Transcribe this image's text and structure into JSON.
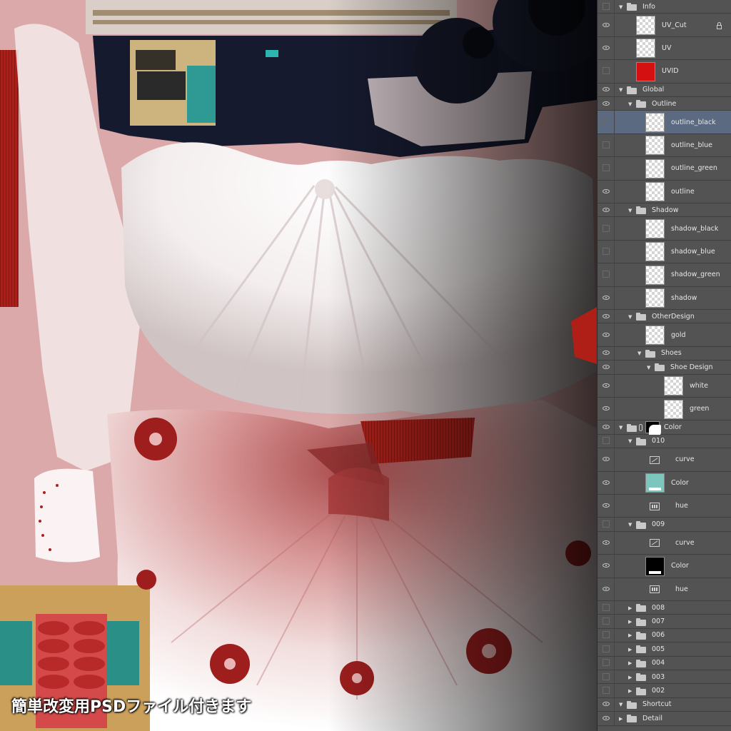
{
  "canvas": {
    "caption": "簡単改変用PSDファイル付きます"
  },
  "layers_panel": {
    "rows": [
      {
        "label": "Info",
        "kind": "group",
        "depth": 0,
        "visible": false,
        "expanded": true,
        "selected": false
      },
      {
        "label": "UV_Cut",
        "kind": "layer",
        "depth": 1,
        "visible": true,
        "thumb": "checker",
        "locked": true,
        "selected": false
      },
      {
        "label": "UV",
        "kind": "layer",
        "depth": 1,
        "visible": true,
        "thumb": "checker",
        "selected": false
      },
      {
        "label": "UVID",
        "kind": "layer",
        "depth": 1,
        "visible": false,
        "thumb": "red",
        "selected": false
      },
      {
        "label": "Global",
        "kind": "group",
        "depth": 0,
        "visible": true,
        "expanded": true,
        "selected": false
      },
      {
        "label": "Outline",
        "kind": "group",
        "depth": 1,
        "visible": true,
        "expanded": true,
        "selected": false
      },
      {
        "label": "outline_black",
        "kind": "layer",
        "depth": 2,
        "visible": false,
        "thumb": "checker",
        "selected": true
      },
      {
        "label": "outline_blue",
        "kind": "layer",
        "depth": 2,
        "visible": false,
        "thumb": "checker",
        "selected": false
      },
      {
        "label": "outline_green",
        "kind": "layer",
        "depth": 2,
        "visible": false,
        "thumb": "checker",
        "selected": false
      },
      {
        "label": "outline",
        "kind": "layer",
        "depth": 2,
        "visible": true,
        "thumb": "checker",
        "selected": false
      },
      {
        "label": "Shadow",
        "kind": "group",
        "depth": 1,
        "visible": true,
        "expanded": true,
        "selected": false
      },
      {
        "label": "shadow_black",
        "kind": "layer",
        "depth": 2,
        "visible": false,
        "thumb": "checker",
        "selected": false
      },
      {
        "label": "shadow_blue",
        "kind": "layer",
        "depth": 2,
        "visible": false,
        "thumb": "checker",
        "selected": false
      },
      {
        "label": "shadow_green",
        "kind": "layer",
        "depth": 2,
        "visible": false,
        "thumb": "checker",
        "selected": false
      },
      {
        "label": "shadow",
        "kind": "layer",
        "depth": 2,
        "visible": true,
        "thumb": "checker",
        "selected": false
      },
      {
        "label": "OtherDesign",
        "kind": "group",
        "depth": 1,
        "visible": true,
        "expanded": true,
        "selected": false
      },
      {
        "label": "gold",
        "kind": "layer",
        "depth": 2,
        "visible": true,
        "thumb": "checker",
        "selected": false
      },
      {
        "label": "Shoes",
        "kind": "group",
        "depth": 2,
        "visible": true,
        "expanded": true,
        "selected": false
      },
      {
        "label": "Shoe Design",
        "kind": "group",
        "depth": 3,
        "visible": true,
        "expanded": true,
        "selected": false
      },
      {
        "label": "white",
        "kind": "layer",
        "depth": 4,
        "visible": true,
        "thumb": "checker",
        "selected": false
      },
      {
        "label": "green",
        "kind": "layer",
        "depth": 4,
        "visible": true,
        "thumb": "checker",
        "selected": false
      },
      {
        "label": "Color",
        "kind": "group-masked",
        "depth": 0,
        "visible": true,
        "expanded": true,
        "selected": false
      },
      {
        "label": "010",
        "kind": "group",
        "depth": 1,
        "visible": false,
        "expanded": true,
        "selected": false
      },
      {
        "label": "curve",
        "kind": "adjust-curve",
        "depth": 2,
        "visible": true,
        "selected": false
      },
      {
        "label": "Color",
        "kind": "fill",
        "depth": 2,
        "visible": true,
        "thumb": "teal",
        "selected": false
      },
      {
        "label": "hue",
        "kind": "adjust-hue",
        "depth": 2,
        "visible": true,
        "selected": false
      },
      {
        "label": "009",
        "kind": "group",
        "depth": 1,
        "visible": false,
        "expanded": true,
        "selected": false
      },
      {
        "label": "curve",
        "kind": "adjust-curve",
        "depth": 2,
        "visible": true,
        "selected": false
      },
      {
        "label": "Color",
        "kind": "fill",
        "depth": 2,
        "visible": true,
        "thumb": "black",
        "selected": false
      },
      {
        "label": "hue",
        "kind": "adjust-hue",
        "depth": 2,
        "visible": true,
        "selected": false
      },
      {
        "label": "008",
        "kind": "group",
        "depth": 1,
        "visible": false,
        "expanded": false,
        "selected": false
      },
      {
        "label": "007",
        "kind": "group",
        "depth": 1,
        "visible": false,
        "expanded": false,
        "selected": false
      },
      {
        "label": "006",
        "kind": "group",
        "depth": 1,
        "visible": false,
        "expanded": false,
        "selected": false
      },
      {
        "label": "005",
        "kind": "group",
        "depth": 1,
        "visible": false,
        "expanded": false,
        "selected": false
      },
      {
        "label": "004",
        "kind": "group",
        "depth": 1,
        "visible": false,
        "expanded": false,
        "selected": false
      },
      {
        "label": "003",
        "kind": "group",
        "depth": 1,
        "visible": false,
        "expanded": false,
        "selected": false
      },
      {
        "label": "002",
        "kind": "group",
        "depth": 1,
        "visible": false,
        "expanded": false,
        "selected": false
      },
      {
        "label": "Shortcut",
        "kind": "group",
        "depth": 0,
        "visible": true,
        "expanded": true,
        "selected": false
      },
      {
        "label": "Detail",
        "kind": "group",
        "depth": 0,
        "visible": true,
        "expanded": false,
        "selected": false
      }
    ]
  },
  "colors": {
    "panel_bg": "#535353",
    "selected_row": "#5b6a80",
    "fabric_red": "#a8241c",
    "flower_red": "#9e1e1e"
  }
}
